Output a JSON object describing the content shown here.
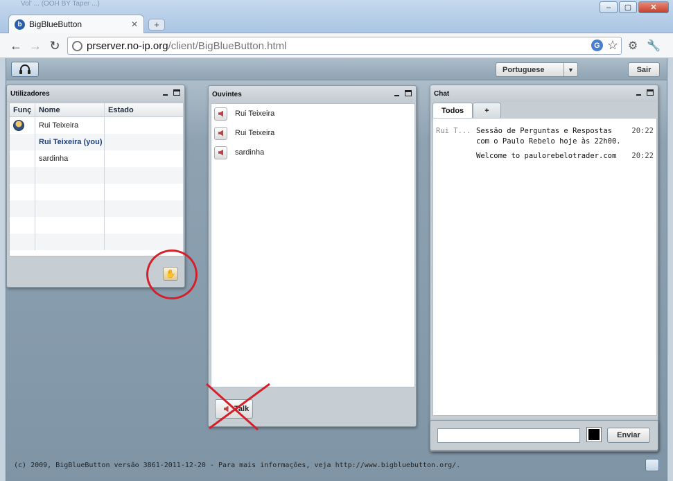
{
  "browser": {
    "background_title": "Vol' ... (OOH BY Taper ...)",
    "tab_title": "BigBlueButton",
    "url_host": "prserver.no-ip.org",
    "url_path": "/client/BigBlueButton.html"
  },
  "app_bar": {
    "language": "Portuguese",
    "logout_label": "Sair"
  },
  "users_panel": {
    "title": "Utilizadores",
    "columns": [
      "Funç",
      "Nome",
      "Estado"
    ],
    "rows": [
      {
        "role": "presenter",
        "name": "Rui Teixeira",
        "status": ""
      },
      {
        "role": "",
        "name": "Rui Teixeira (you)",
        "status": ""
      },
      {
        "role": "",
        "name": "sardinha",
        "status": ""
      }
    ]
  },
  "listeners_panel": {
    "title": "Ouvintes",
    "listeners": [
      "Rui Teixeira",
      "Rui Teixeira",
      "sardinha"
    ],
    "talk_label": "Talk"
  },
  "chat_panel": {
    "title": "Chat",
    "tabs": [
      "Todos",
      "+"
    ],
    "messages": [
      {
        "sender": "Rui T...",
        "text": "Sessão de Perguntas e Respostas com o Paulo Rebelo hoje às 22h00.",
        "time": "20:22"
      },
      {
        "sender": "",
        "text": "Welcome to paulorebelotrader.com",
        "time": "20:22"
      }
    ],
    "input_value": "",
    "send_label": "Enviar",
    "text_color": "#000000"
  },
  "footer": {
    "text": "(c) 2009, BigBlueButton versão 3861-2011-12-20 - Para mais informações, veja http://www.bigbluebutton.org/."
  },
  "colors": {
    "annotation_red": "#d4202a",
    "app_background": "#8ea2b2"
  }
}
